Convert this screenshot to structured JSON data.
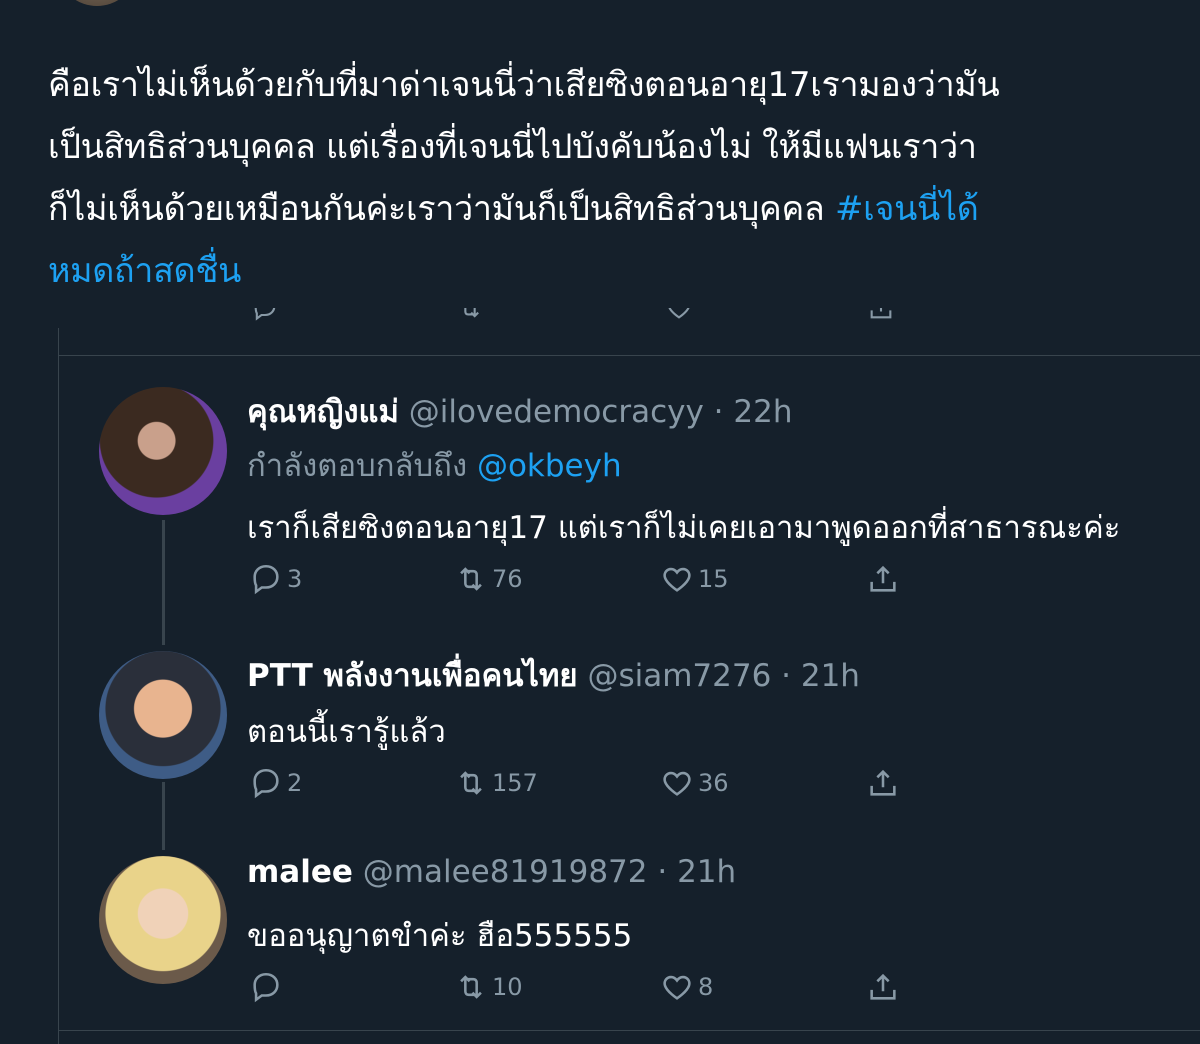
{
  "tweet": {
    "lines": [
      "คือเราไม่เห็นด้วยกับที่มาด่าเจนนี่ว่าเสียซิงตอนอายุ17เรามองว่ามัน",
      "เป็นสิทธิส่วนบุคคล แต่เรื่องที่เจนนี่ไปบังคับน้องไม่ ให้มีแฟนเราว่า",
      "ก็ไม่เห็นด้วยเหมือนกันค่ะเราว่ามันก็เป็นสิทธิส่วนบุคคล "
    ],
    "hashtag_part1": "#เจนนี่ได้",
    "hashtag_part2": "หมดถ้าสดชื่น"
  },
  "replies": [
    {
      "name": "คุณหญิงแม่",
      "handle": "@ilovedemocracyy · 22h",
      "replying_label": "กำลังตอบกลับถึง ",
      "replying_to": "@okbeyh",
      "text": "เราก็เสียซิงตอนอายุ17 แต่เราก็ไม่เคยเอามาพูดออกที่สาธารณะค่ะ",
      "replies_count": "3",
      "retweets_count": "76",
      "likes_count": "15"
    },
    {
      "name": "PTT พลังงานเพื่อคนไทย",
      "handle": "@siam7276 · 21h",
      "text": "ตอนนี้เรารู้แล้ว",
      "replies_count": "2",
      "retweets_count": "157",
      "likes_count": "36"
    },
    {
      "name": "malee",
      "handle": "@malee81919872 · 21h",
      "text": "ขออนุญาตขำค่ะ ฮือ555555",
      "replies_count": "",
      "retweets_count": "10",
      "likes_count": "8"
    }
  ],
  "icons": {
    "reply": "comment-icon",
    "retweet": "retweet-icon",
    "like": "heart-icon",
    "share": "share-icon"
  },
  "colors": {
    "background": "#15202b",
    "accent": "#1da1f2",
    "secondary_text": "#8899a6",
    "border": "#38444d"
  }
}
